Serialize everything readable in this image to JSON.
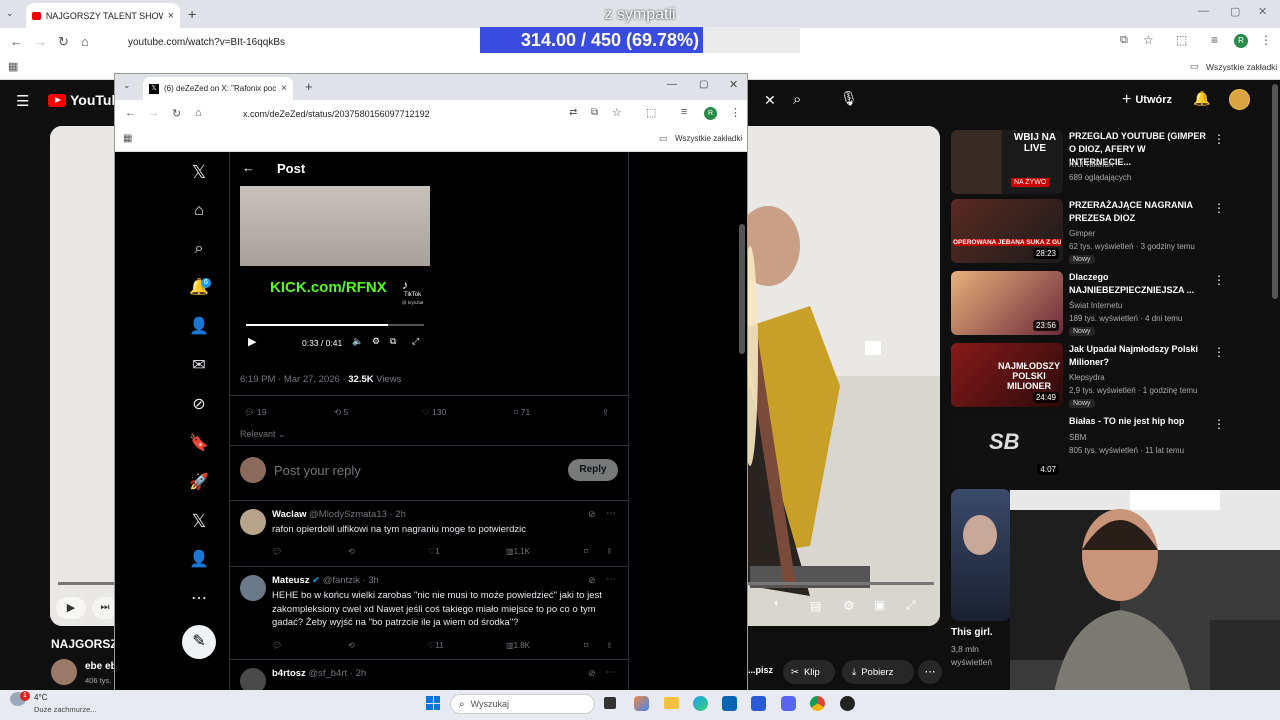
{
  "outer_browser": {
    "tab_title": "NAJGORSZY TALENT SHOW W",
    "url": "youtube.com/watch?v=BIt-16qqkBs",
    "bookmarks_label": "Wszystkie zakładki"
  },
  "stream_overlay": {
    "title": "z sympatii",
    "progress_text": "314.00 / 450 (69.78%)",
    "progress_fraction": 0.6978
  },
  "youtube": {
    "logo": "YouTube",
    "create_label": "Utwórz",
    "video_title": "NAJGORSZ",
    "channel_name": "ebe eb",
    "channel_subs": "406 tys.",
    "actions": {
      "share": "...pisz",
      "clip": "Klip",
      "download": "Pobierz"
    },
    "short_title": "This girl.",
    "short_views": "3,8 mln",
    "short_views2": "wyświetleń",
    "recommendations": [
      {
        "title": "PRZEGLAD YOUTUBE (GIMPER O DIOZ, AFERY W INTERNECIE...",
        "channel": "Krul Takefun",
        "meta": "689 oglądających",
        "duration": "",
        "badge": "",
        "thumb_text": "WBIJ NA LIVE",
        "live": "NA ŻYWO"
      },
      {
        "title": "PRZERAŻAJĄCE NAGRANIA PREZESA DIOZ",
        "channel": "Gimper",
        "meta": "62 tys. wyświetleń · 3 godziny temu",
        "duration": "28:23",
        "badge": "Nowy",
        "thumb_text": "OPEROWANA JEBANA SUKA Z GUZEM",
        "live": ""
      },
      {
        "title": "Dlaczego NAJNIEBEZPIECZNIEJSZA ...",
        "channel": "Świat Internetu",
        "meta": "189 tys. wyświetleń · 4 dni temu",
        "duration": "23:56",
        "badge": "Nowy",
        "thumb_text": "",
        "live": ""
      },
      {
        "title": "Jak Upadał Najmłodszy Polski Milioner?",
        "channel": "Klepsydra",
        "meta": "2,9 tys. wyświetleń · 1 godzinę temu",
        "duration": "24:49",
        "badge": "Nowy",
        "thumb_text": "NAJMŁODSZY POLSKI MILIONER",
        "live": ""
      },
      {
        "title": "Białas - TO nie jest hip hop",
        "channel": "SBM",
        "meta": "805 tys. wyświetleń · 11 lat temu",
        "duration": "4:07",
        "badge": "",
        "thumb_text": "SB",
        "live": ""
      }
    ]
  },
  "inner_browser": {
    "tab_title": "(6) deZeZed on X: \"Rafonix poc",
    "url": "x.com/deZeZed/status/2037580156097712192",
    "bookmarks_label": "Wszystkie zakładki"
  },
  "x": {
    "header": "Post",
    "notif_count": "6",
    "video": {
      "brand": "KICK.com/RFNX",
      "tiktok": "TikTok",
      "tiktok_user": "@ kryształ",
      "time": "0:33 / 0:41",
      "progress_fraction": 0.8
    },
    "meta_time": "6:19 PM · Mar 27, 2026 · ",
    "views_count": "32.5K",
    "views_label": " Views",
    "stats": {
      "replies": "19",
      "reposts": "5",
      "likes": "130",
      "bookmarks": "71"
    },
    "sort_label": "Relevant",
    "reply_placeholder": "Post your reply",
    "reply_button": "Reply",
    "replies": [
      {
        "name": "Waclaw",
        "handle": "@MlodySzmata13 · 2h",
        "text": "rafon opierdolil ulfikowi na tym nagraniu moge to potwierdzic",
        "replies": "",
        "likes": "1",
        "views": "1.1K"
      },
      {
        "name": "Mateusz",
        "handle": "@fantzik · 3h",
        "text": "HEHE bo w końcu wielki zarobas \"nic nie musi to może powiedzieć\" jaki to jest zakompleksiony cwel xd Nawet jeśli coś takiego miało miejsce to po co o tym gadać? Żeby wyjść na \"bo patrzcie ile ja wiem od środka\"?",
        "replies": "",
        "likes": "11",
        "views": "1.8K"
      },
      {
        "name": "b4rtosz",
        "handle": "@sf_b4rt · 2h",
        "text": "",
        "replies": "",
        "likes": "",
        "views": ""
      }
    ]
  },
  "taskbar": {
    "temp": "4°C",
    "weather": "Duże zachmurze...",
    "search": "Wyszukaj",
    "weather_badge": "1"
  },
  "colors": {
    "progress_fill": "#3a4be0",
    "x_blue": "#1d9bf0",
    "yt_red": "#ff0000"
  }
}
